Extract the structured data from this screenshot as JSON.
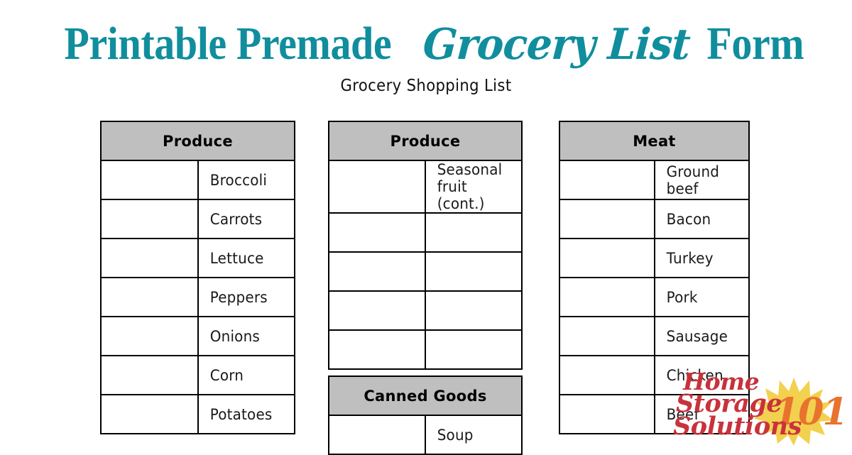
{
  "page": {
    "title_prefix": "Printable Premade ",
    "title_script": "Grocery List",
    "title_suffix": " Form",
    "subtitle": "Grocery Shopping List",
    "title_color": "#108e9e",
    "header_fill": "#bfbfbf",
    "border_color": "#000000",
    "background": "#ffffff"
  },
  "columns": [
    {
      "id": "column-1",
      "tables": [
        {
          "header": "Produce",
          "rows": [
            {
              "checked": false,
              "item": "Broccoli"
            },
            {
              "checked": false,
              "item": "Carrots"
            },
            {
              "checked": false,
              "item": "Lettuce"
            },
            {
              "checked": false,
              "item": "Peppers"
            },
            {
              "checked": false,
              "item": "Onions"
            },
            {
              "checked": false,
              "item": "Corn"
            },
            {
              "checked": false,
              "item": "Potatoes"
            }
          ]
        }
      ]
    },
    {
      "id": "column-2",
      "tables": [
        {
          "header": "Produce",
          "rows": [
            {
              "checked": false,
              "item": "Seasonal fruit (cont.)"
            },
            {
              "checked": false,
              "item": ""
            },
            {
              "checked": false,
              "item": ""
            },
            {
              "checked": false,
              "item": ""
            },
            {
              "checked": false,
              "item": ""
            }
          ]
        },
        {
          "header": "Canned Goods",
          "rows": [
            {
              "checked": false,
              "item": "Soup"
            }
          ]
        }
      ]
    },
    {
      "id": "column-3",
      "tables": [
        {
          "header": "Meat",
          "rows": [
            {
              "checked": false,
              "item": "Ground beef"
            },
            {
              "checked": false,
              "item": "Bacon"
            },
            {
              "checked": false,
              "item": "Turkey"
            },
            {
              "checked": false,
              "item": "Pork"
            },
            {
              "checked": false,
              "item": "Sausage"
            },
            {
              "checked": false,
              "item": "Chicken"
            },
            {
              "checked": false,
              "item": "Beef"
            }
          ]
        }
      ]
    }
  ],
  "watermark": {
    "line_1": "Home",
    "line_2": "Storage",
    "line_3": "Solutions",
    "badge": "101",
    "script_color": "#c8323c",
    "sun_color": "#f2d14e",
    "badge_color": "#e8732e"
  }
}
